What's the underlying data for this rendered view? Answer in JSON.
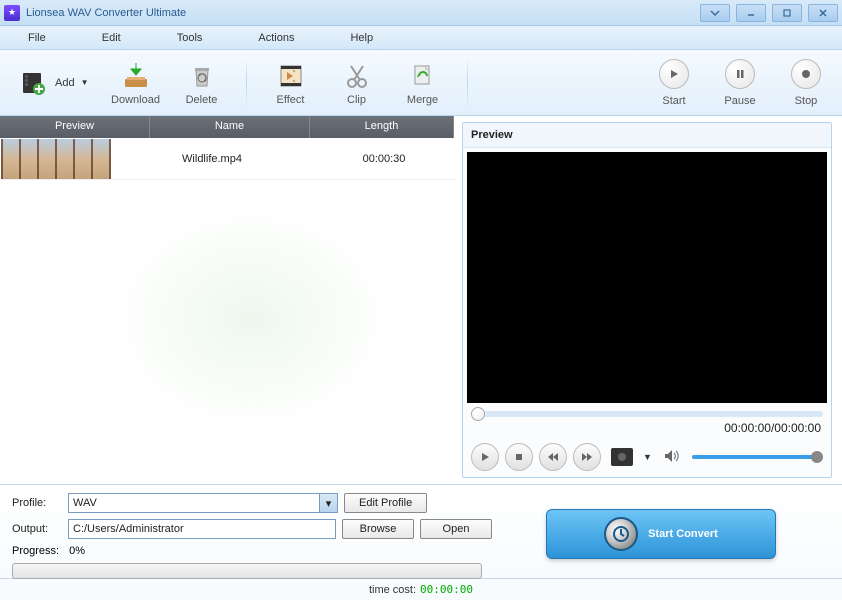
{
  "window": {
    "title": "Lionsea WAV Converter Ultimate"
  },
  "menu": {
    "file": "File",
    "edit": "Edit",
    "tools": "Tools",
    "actions": "Actions",
    "help": "Help"
  },
  "toolbar": {
    "add": "Add",
    "download": "Download",
    "delete": "Delete",
    "effect": "Effect",
    "clip": "Clip",
    "merge": "Merge",
    "start": "Start",
    "pause": "Pause",
    "stop": "Stop"
  },
  "columns": {
    "preview": "Preview",
    "name": "Name",
    "length": "Length"
  },
  "files": [
    {
      "name": "Wildlife.mp4",
      "length": "00:00:30"
    }
  ],
  "preview": {
    "header": "Preview",
    "time": "00:00:00/00:00:00"
  },
  "settings": {
    "profile_label": "Profile:",
    "profile_value": "WAV",
    "edit_profile": "Edit Profile",
    "output_label": "Output:",
    "output_value": "C:/Users/Administrator",
    "browse": "Browse",
    "open": "Open",
    "progress_label": "Progress:",
    "progress_value": "0%"
  },
  "convert": {
    "label": "Start Convert"
  },
  "status": {
    "time_cost_label": "time cost:",
    "time_cost_value": "00:00:00"
  }
}
